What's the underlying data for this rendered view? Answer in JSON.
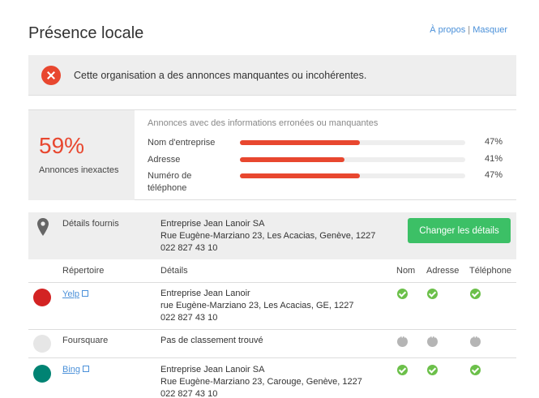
{
  "page": {
    "title": "Présence locale"
  },
  "links": {
    "about": "À propos",
    "separator": "|",
    "hide": "Masquer"
  },
  "alert": {
    "message": "Cette organisation a des annonces manquantes ou incohérentes."
  },
  "summary": {
    "percent": "59%",
    "percent_label": "Annonces inexactes",
    "heading": "Annonces avec des informations erronées ou manquantes",
    "bars": [
      {
        "label": "Nom d'entreprise",
        "value": 47,
        "value_label": "47%"
      },
      {
        "label": "Adresse",
        "value": 41,
        "value_label": "41%"
      },
      {
        "label": "Numéro de téléphone",
        "value": 47,
        "value_label": "47%"
      }
    ]
  },
  "provided": {
    "label": "Détails fournis",
    "lines": [
      "Entreprise Jean Lanoir SA",
      "Rue Eugène-Marziano 23, Les Acacias, Genève, 1227",
      "022 827 43 10"
    ],
    "button": "Changer les détails"
  },
  "table": {
    "headers": {
      "directory": "Répertoire",
      "details": "Détails",
      "name": "Nom",
      "address": "Adresse",
      "phone": "Téléphone"
    },
    "rows": [
      {
        "directory": "Yelp",
        "lines": [
          "Entreprise Jean Lanoir",
          "rue Eugène-Marziano 23, Les Acacias, GE, 1227",
          "022 827 43 10"
        ],
        "name": "ok",
        "address": "ok",
        "phone": "ok"
      },
      {
        "directory": "Foursquare",
        "lines": [
          "Pas de classement trouvé"
        ],
        "name": "na",
        "address": "na",
        "phone": "na"
      },
      {
        "directory": "Bing",
        "lines": [
          "Entreprise Jean Lanoir SA",
          "Rue Eugène-Marziano 23, Carouge, Genève, 1227",
          "022 827 43 10"
        ],
        "name": "ok",
        "address": "ok",
        "phone": "ok"
      }
    ]
  },
  "colors": {
    "accent": "#e8472f",
    "button": "#3cc066",
    "link": "#4a90d9",
    "ok": "#6cc04a",
    "na": "#b5b5b5"
  }
}
